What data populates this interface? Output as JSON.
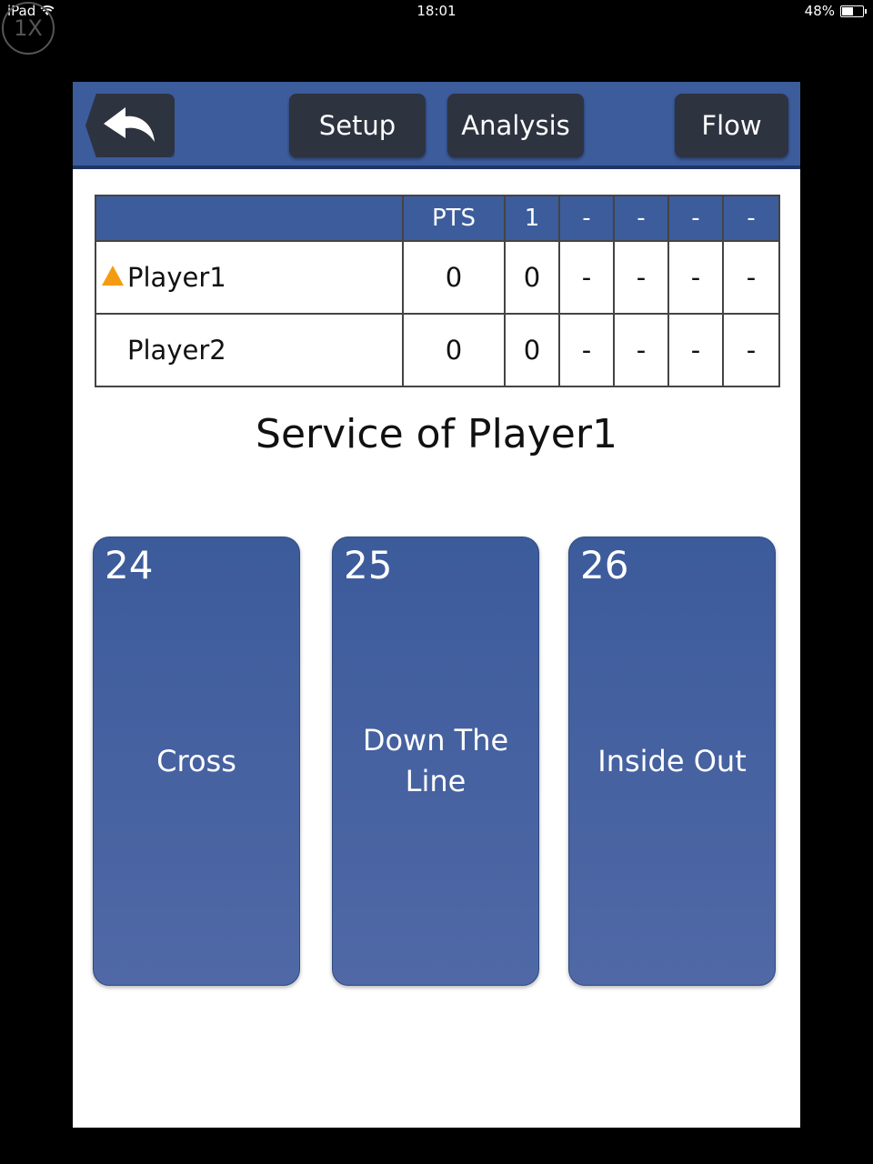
{
  "status_bar": {
    "device": "iPad",
    "time": "18:01",
    "battery": "48%",
    "battery_level": 0.48
  },
  "zoom_badge": "1X",
  "toolbar": {
    "setup": "Setup",
    "analysis": "Analysis",
    "flow": "Flow"
  },
  "scoreboard": {
    "headers": [
      "",
      "PTS",
      "1",
      "-",
      "-",
      "-",
      "-"
    ],
    "rows": [
      {
        "name": "Player1",
        "serving": true,
        "cells": [
          "0",
          "0",
          "-",
          "-",
          "-",
          "-"
        ]
      },
      {
        "name": "Player2",
        "serving": false,
        "cells": [
          "0",
          "0",
          "-",
          "-",
          "-",
          "-"
        ]
      }
    ]
  },
  "service_title": "Service of Player1",
  "shots": [
    {
      "number": "24",
      "label": "Cross"
    },
    {
      "number": "25",
      "label": "Down The Line"
    },
    {
      "number": "26",
      "label": "Inside Out"
    }
  ],
  "colors": {
    "primary": "#3c5c9c",
    "button_dark": "#2e3340",
    "serve_marker": "#f39c12"
  }
}
